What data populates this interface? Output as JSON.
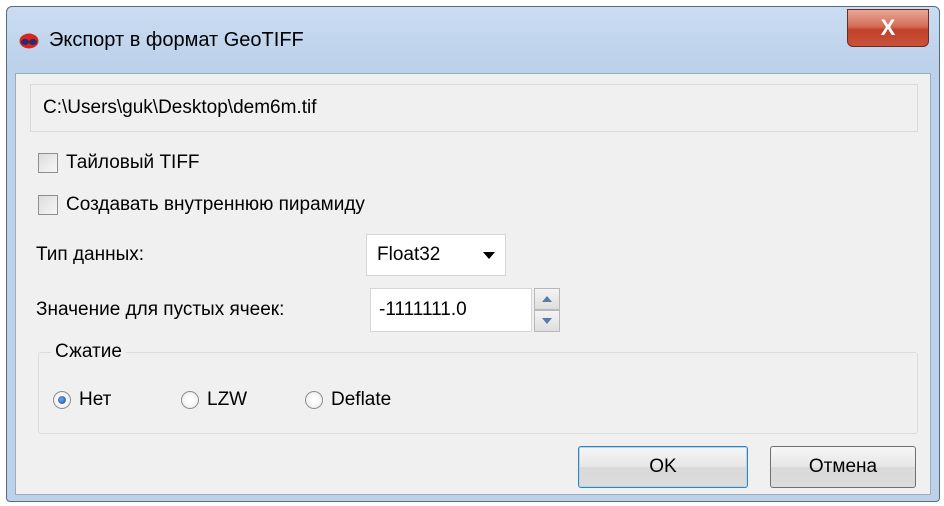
{
  "window": {
    "title": "Экспорт в формат GeoTIFF",
    "close_label": "X"
  },
  "path": {
    "value": "C:\\Users\\guk\\Desktop\\dem6m.tif"
  },
  "options": {
    "tiled_tiff": {
      "label": "Тайловый TIFF",
      "checked": false
    },
    "internal_pyramid": {
      "label": "Создавать внутреннюю пирамиду",
      "checked": false
    }
  },
  "data_type": {
    "label": "Тип данных:",
    "selected": "Float32"
  },
  "nodata": {
    "label": "Значение для пустых ячеек:",
    "value": "-1111111.0"
  },
  "compression": {
    "title": "Сжатие",
    "options": [
      {
        "label": "Нет",
        "selected": true
      },
      {
        "label": "LZW",
        "selected": false
      },
      {
        "label": "Deflate",
        "selected": false
      }
    ]
  },
  "buttons": {
    "ok": "OK",
    "cancel": "Отмена"
  }
}
